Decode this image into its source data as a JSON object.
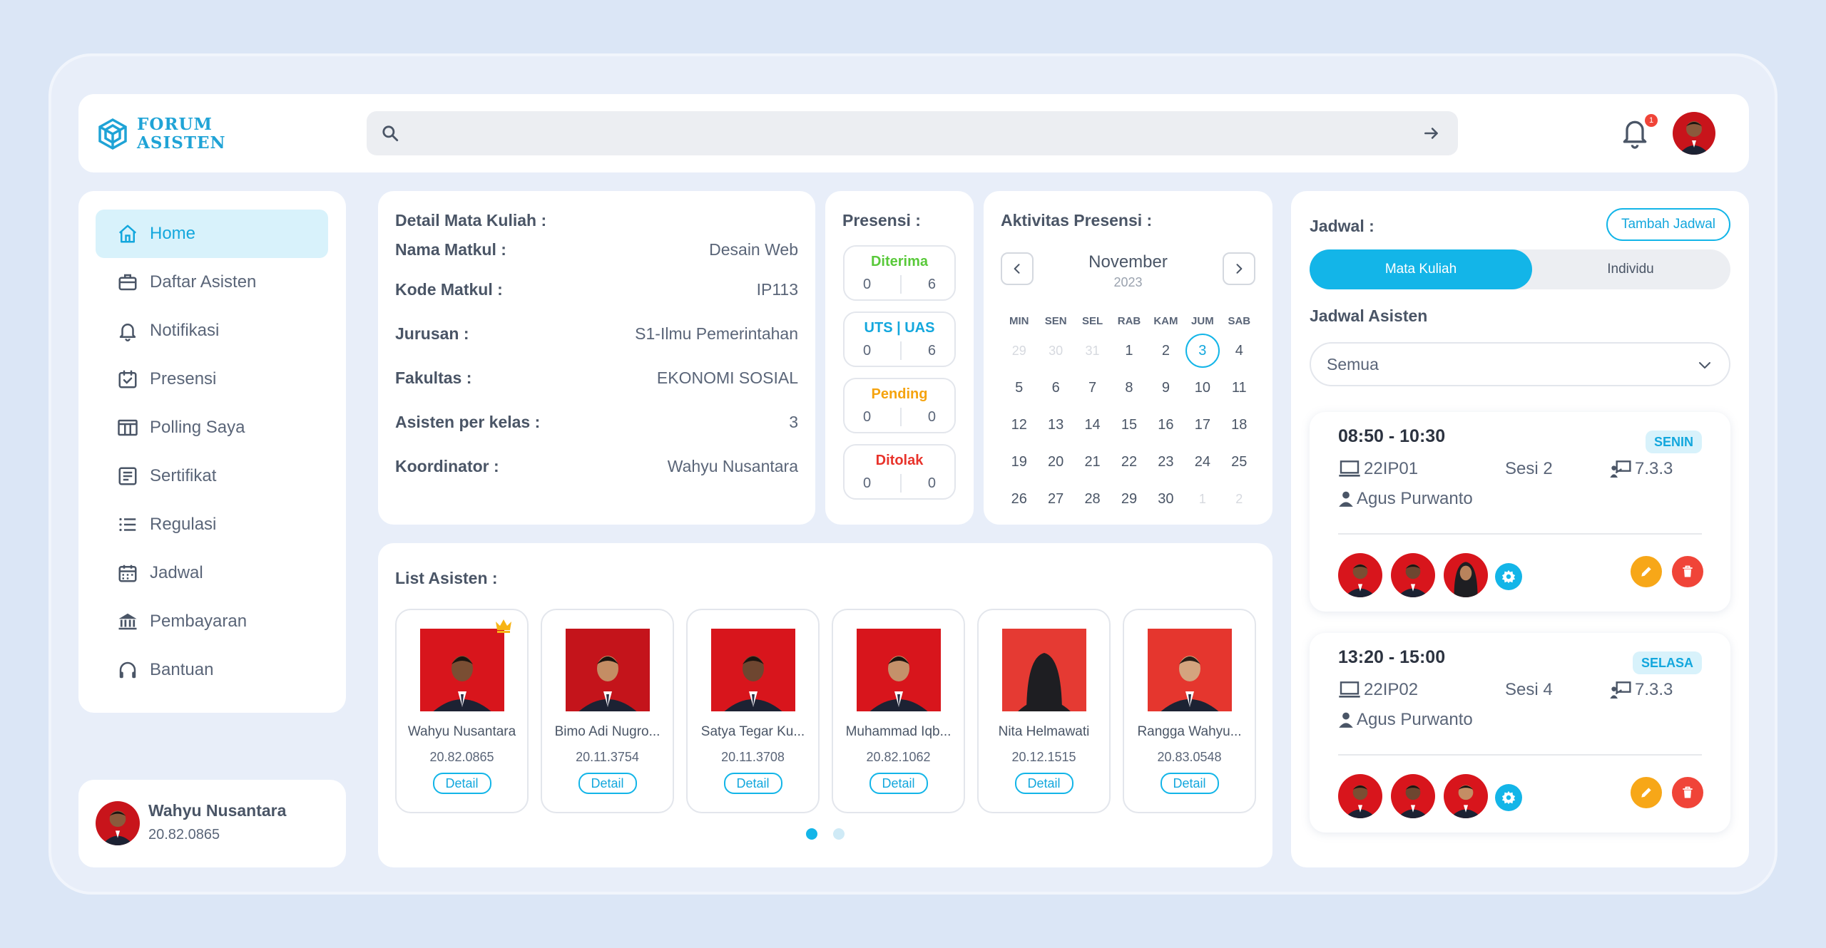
{
  "app": {
    "logo_line1": "FORUM",
    "logo_line2": "ASISTEN",
    "search_placeholder": "",
    "notif_count": "1",
    "accent_color": "#13b5e8"
  },
  "sidebar": {
    "items": [
      {
        "label": "Home",
        "icon": "home-icon"
      },
      {
        "label": "Daftar Asisten",
        "icon": "briefcase-icon"
      },
      {
        "label": "Notifikasi",
        "icon": "bell-icon"
      },
      {
        "label": "Presensi",
        "icon": "calendar-check-icon"
      },
      {
        "label": "Polling Saya",
        "icon": "columns-icon"
      },
      {
        "label": "Sertifikat",
        "icon": "document-icon"
      },
      {
        "label": "Regulasi",
        "icon": "list-icon"
      },
      {
        "label": "Jadwal",
        "icon": "calendar-icon"
      },
      {
        "label": "Pembayaran",
        "icon": "bank-icon"
      },
      {
        "label": "Bantuan",
        "icon": "headphones-icon"
      }
    ],
    "active_index": 0
  },
  "user": {
    "name": "Wahyu Nusantara",
    "id": "20.82.0865"
  },
  "detail": {
    "title": "Detail Mata Kuliah :",
    "rows": [
      {
        "key": "Nama Matkul :",
        "value": "Desain Web"
      },
      {
        "key": "Kode Matkul :",
        "value": "IP113"
      },
      {
        "key": "Jurusan :",
        "value": "S1-Ilmu Pemerintahan"
      },
      {
        "key": "Fakultas :",
        "value": "EKONOMI SOSIAL"
      },
      {
        "key": "Asisten per kelas :",
        "value": "3"
      },
      {
        "key": "Koordinator :",
        "value": "Wahyu Nusantara"
      }
    ]
  },
  "presensi": {
    "title": "Presensi :",
    "items": [
      {
        "label": "Diterima",
        "a": "0",
        "b": "6",
        "color": "#59c93a"
      },
      {
        "label": "UTS | UAS",
        "a": "0",
        "b": "6",
        "color": "#13a7dd"
      },
      {
        "label": "Pending",
        "a": "0",
        "b": "0",
        "color": "#f5a30e"
      },
      {
        "label": "Ditolak",
        "a": "0",
        "b": "0",
        "color": "#e8332b"
      }
    ]
  },
  "calendar": {
    "title": "Aktivitas Presensi :",
    "month": "November",
    "year": "2023",
    "weekdays": [
      "MIN",
      "SEN",
      "SEL",
      "RAB",
      "KAM",
      "JUM",
      "SAB"
    ],
    "days": [
      {
        "d": "29",
        "m": true
      },
      {
        "d": "30",
        "m": true
      },
      {
        "d": "31",
        "m": true
      },
      {
        "d": "1"
      },
      {
        "d": "2"
      },
      {
        "d": "3",
        "today": true
      },
      {
        "d": "4"
      },
      {
        "d": "5"
      },
      {
        "d": "6"
      },
      {
        "d": "7"
      },
      {
        "d": "8"
      },
      {
        "d": "9"
      },
      {
        "d": "10"
      },
      {
        "d": "11"
      },
      {
        "d": "12"
      },
      {
        "d": "13"
      },
      {
        "d": "14"
      },
      {
        "d": "15"
      },
      {
        "d": "16"
      },
      {
        "d": "17"
      },
      {
        "d": "18"
      },
      {
        "d": "19"
      },
      {
        "d": "20"
      },
      {
        "d": "21"
      },
      {
        "d": "22"
      },
      {
        "d": "23"
      },
      {
        "d": "24"
      },
      {
        "d": "25"
      },
      {
        "d": "26"
      },
      {
        "d": "27"
      },
      {
        "d": "28"
      },
      {
        "d": "29"
      },
      {
        "d": "30"
      },
      {
        "d": "1",
        "m": true
      },
      {
        "d": "2",
        "m": true
      }
    ]
  },
  "list": {
    "title": "List Asisten :",
    "detail_label": "Detail",
    "assistants": [
      {
        "name": "Wahyu Nusantara",
        "id": "20.82.0865",
        "leader": true
      },
      {
        "name": "Bimo Adi Nugro...",
        "id": "20.11.3754"
      },
      {
        "name": "Satya Tegar Ku...",
        "id": "20.11.3708"
      },
      {
        "name": "Muhammad Iqb...",
        "id": "20.82.1062"
      },
      {
        "name": "Nita Helmawati",
        "id": "20.12.1515",
        "hijab": true
      },
      {
        "name": "Rangga Wahyu...",
        "id": "20.83.0548"
      }
    ]
  },
  "jadwal": {
    "title": "Jadwal :",
    "add_button": "Tambah Jadwal",
    "tab_active": "Mata Kuliah",
    "tab_other": "Individu",
    "subtitle": "Jadwal Asisten",
    "filter_value": "Semua",
    "schedules": [
      {
        "time": "08:50 - 10:30",
        "day": "SENIN",
        "class": "22IP01",
        "session": "Sesi 2",
        "room": "7.3.3",
        "lecturer": "Agus Purwanto"
      },
      {
        "time": "13:20 - 15:00",
        "day": "SELASA",
        "class": "22IP02",
        "session": "Sesi 4",
        "room": "7.3.3",
        "lecturer": "Agus Purwanto"
      }
    ]
  }
}
